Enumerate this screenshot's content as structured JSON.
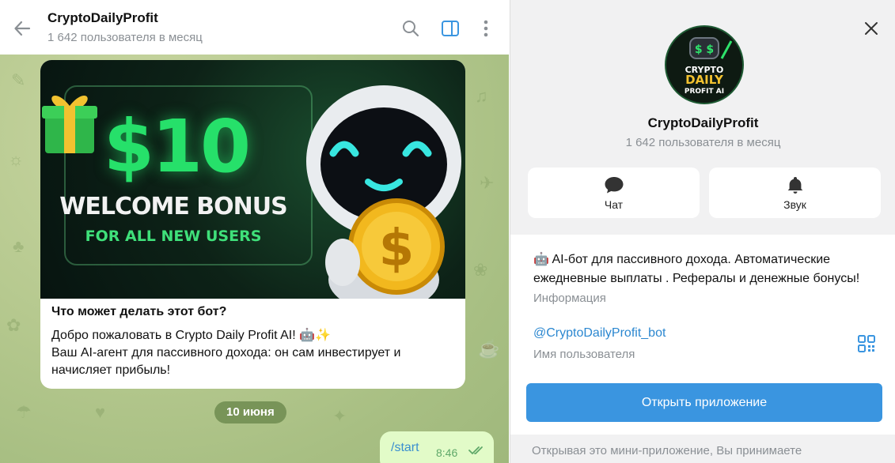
{
  "chat": {
    "header": {
      "title": "CryptoDailyProfit",
      "subtitle": "1 642 пользователя в месяц"
    },
    "message": {
      "banner": {
        "amount": "$10",
        "title": "WELCOME BONUS",
        "subtitle": "FOR ALL NEW USERS"
      },
      "question": "Что может делать этот бот?",
      "body_line1": "Добро пожаловать в Crypto Daily Profit AI! 🤖✨",
      "body_line2": "Ваш AI-агент для пассивного дохода: он сам инвестирует и",
      "body_line3": "начисляет прибыль!"
    },
    "date_pill": "10 июня",
    "outgoing": {
      "text": "/start",
      "time": "8:46"
    }
  },
  "info": {
    "name": "CryptoDailyProfit",
    "subtitle": "1 642 пользователя в месяц",
    "avatar_text": [
      "CRYPTO",
      "DAILY",
      "PROFIT AI"
    ],
    "actions": [
      {
        "label": "Чат",
        "icon": "chat-bubble-icon"
      },
      {
        "label": "Звук",
        "icon": "bell-icon"
      }
    ],
    "about": "🤖 AI-бот для пассивного дохода. Автоматические ежедневные выплаты . Рефералы и денежные бонусы!",
    "about_label": "Информация",
    "username": "@CryptoDailyProfit_bot",
    "username_label": "Имя пользователя",
    "open_app_label": "Открыть приложение",
    "footer_note": "Открывая это мини-приложение, Вы принимаете"
  },
  "colors": {
    "accent": "#3a95e0",
    "link": "#2b87d0",
    "bonus_green": "#26e06a",
    "bubble_out": "#e2fbc8"
  }
}
